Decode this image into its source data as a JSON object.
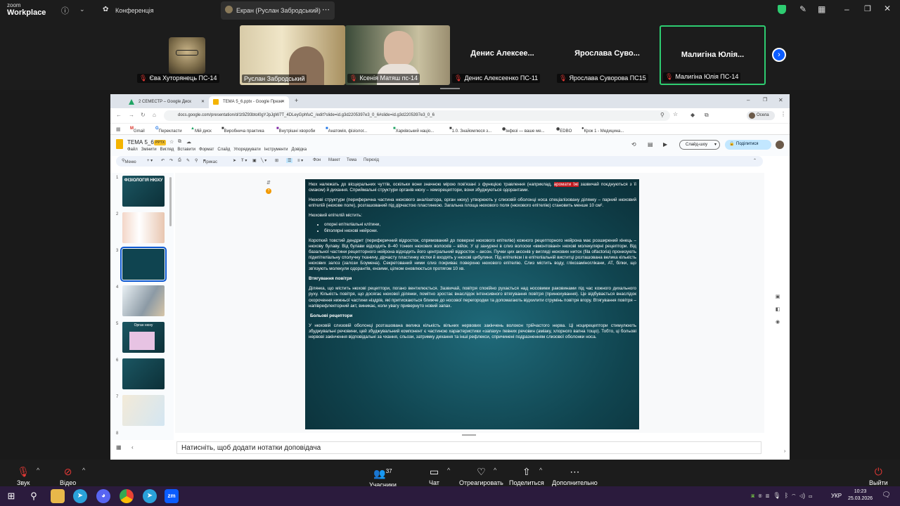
{
  "zoom": {
    "logo_line1": "zoom",
    "logo_line2": "Workplace",
    "conference": "Конференція",
    "screen_title": "Екран (Руслан Забродський)",
    "participants": [
      {
        "name": "Єва Хуторянець ПС-14"
      },
      {
        "name": "Руслан Забродський"
      },
      {
        "name": "Ксенія Матяш пс-14"
      },
      {
        "name": "Денис Алексеенко ПС-11",
        "display": "Денис  Алексее..."
      },
      {
        "name": "Ярослава Суворова ПС15",
        "display": "Ярослава  Суво..."
      },
      {
        "name": "Малигіна Юлія ПС-14",
        "display": "Малигіна  Юлія..."
      }
    ],
    "controls": {
      "audio": "Звук",
      "video": "Відео",
      "participants": "Учасники",
      "participants_count": "37",
      "chat": "Чат",
      "react": "Отреагировать",
      "share": "Поделиться",
      "more": "Дополнительно",
      "leave": "Выйти"
    }
  },
  "browser": {
    "tabs": [
      {
        "label": "2 СЕМЕСТР – Google Диск"
      },
      {
        "label": "ТЕМА 5_6.pptx - Google Презе"
      }
    ],
    "url": "docs.google.com/presentation/d/1t9Z93btol0gYJpJgW7T_4DLeyGphfuC_/edit?slide=id.g3d2205397e3_0_6#slide=id.g3d2205397e3_0_6",
    "profile": "Ocела",
    "bookmarks": [
      "Gmail",
      "Перекласти",
      "Мій диск",
      "Виробнича практика",
      "Внутрішні хвороби",
      "Анатомія, фізіолог...",
      "Харківський націо...",
      "1.0. Знайомлюся з...",
      "Iнфезі — ваше ме...",
      "EDBO",
      "Крок 1 - Медицина..."
    ]
  },
  "slides": {
    "title": "ТЕМА 5_6",
    "badge": "PPTX",
    "menu": [
      "Файл",
      "Змінити",
      "Вигляд",
      "Вставити",
      "Формат",
      "Слайд",
      "Упорядкувати",
      "Інструменти",
      "Довідка"
    ],
    "toolbar": [
      "Меню",
      "Прикас",
      "Фон",
      "Макет",
      "Тема",
      "Перехід"
    ],
    "slideshow_btn": "Слайд-шоу",
    "share_btn": "Поділитися",
    "thumbs": [
      "ФІЗІОЛОГІЯ НЮХУ",
      "",
      "",
      "",
      "Орган нюху",
      "",
      "",
      ""
    ],
    "notes_placeholder": "Натисніть, щоб додати нотатки доповідача",
    "slide": {
      "p1a": "Нюх належать до вісцеральних чуттів, оскільки вони значною мірою пов'язані з функцією травлення (наприклад, ",
      "p1hl": "аромати їжі",
      "p1b": " зазвичай поєднуються з її смаком) й дихання. Сприймальні структури органів нюху – хеморецептори, вони збуджуються одорантами.",
      "p2": "Нюхові структури (периферична частина нюхового аналізатора, орган нюху) утворюють у слизовій оболонці носа спеціалізовану ділянку – парний нюховий епітелій (нюхове поле), розташований під дірчастою пластинкою. Загальна площа нюхового поля (нюхового епітелію) становить менше 10 см².",
      "p3": "Нюховий епітелій містить:",
      "li1": "опорні епітеліальні клітини,",
      "li2": "біполярні нюхові нейрони.",
      "p4": "Короткий товстий дендрит (периферичний відросток, спрямований до поверхні нюхового епітелію) кожного рецепторного нейрона має розширений кінець – нюхову булаву. Від булави відходить 8–40 тонких нюхових волосків – війок. У ці занурені в слиз волоски «вмонтовані» нюхові молекулярні рецептори. Від базальної частини рецепторного нейрона відходить його центральний відросток – аксон. Пучки цих аксонів у вигляді нюхових нитох (fila olfactoria) пронизують підепітеліальну сполучну тканину, дірчасту пластинку кістки й входять у нюхові цибулини. Під епітелієм і в епітеліальній виститці розташована велика кількість нюхових залоз (залози Боумена). Секретований ними слиз покриває поверхню нюхового епітелію. Слиз містить воду, глікозаміноглікани, АТ, білки, що зв'язують молекули одорантів, ензими, цілком оновлюється протягом 10 хв.",
      "h1": "Втягування повітря",
      "p5": "Ділянка, що містить нюхові рецептори, погано вентилюється. Зазвичай, повітря спокійно рухається над носовими раковинами під час кожного дихального руху. Кількість повітря, що досягає нюхової ділянки, помітно зростає внаслідок інтенсивного втягування повітря (принюхування). Це відбувається внаслідок скорочення нижньої частини ніздрів, які притискаються ближче до носової перегородки та допомагають відхилити струмінь повітря вгору. Втягування повітря – напіврефлекторний акт, виникає, коли увагу привернуто новий запах.",
      "h2": "Больові рецептори",
      "p6": "У нюховій слизовій оболонці розташована велика кількість вільних нервових закінчень волокон трійчастого нерва. Ці ноцирецептори стимулюють збуджувальні речовини, цей збуджувальний компонент є частиною характеристики «запаху» певних речовин (аміаку, хлорного вапна тощо). Тобто, ці больові нервові закінчення відповідальні за чхання, сльози, затримку дихання та інші рефлекси, спричинені подразненням слизової оболонки носа."
    }
  },
  "taskbar": {
    "lang": "УКР",
    "time": "10:23",
    "date": "25.03.2026"
  },
  "colors": {
    "accent_green": "#2ecc71",
    "highlight_red": "#c0181e",
    "zoom_blue": "#0b5cff"
  }
}
